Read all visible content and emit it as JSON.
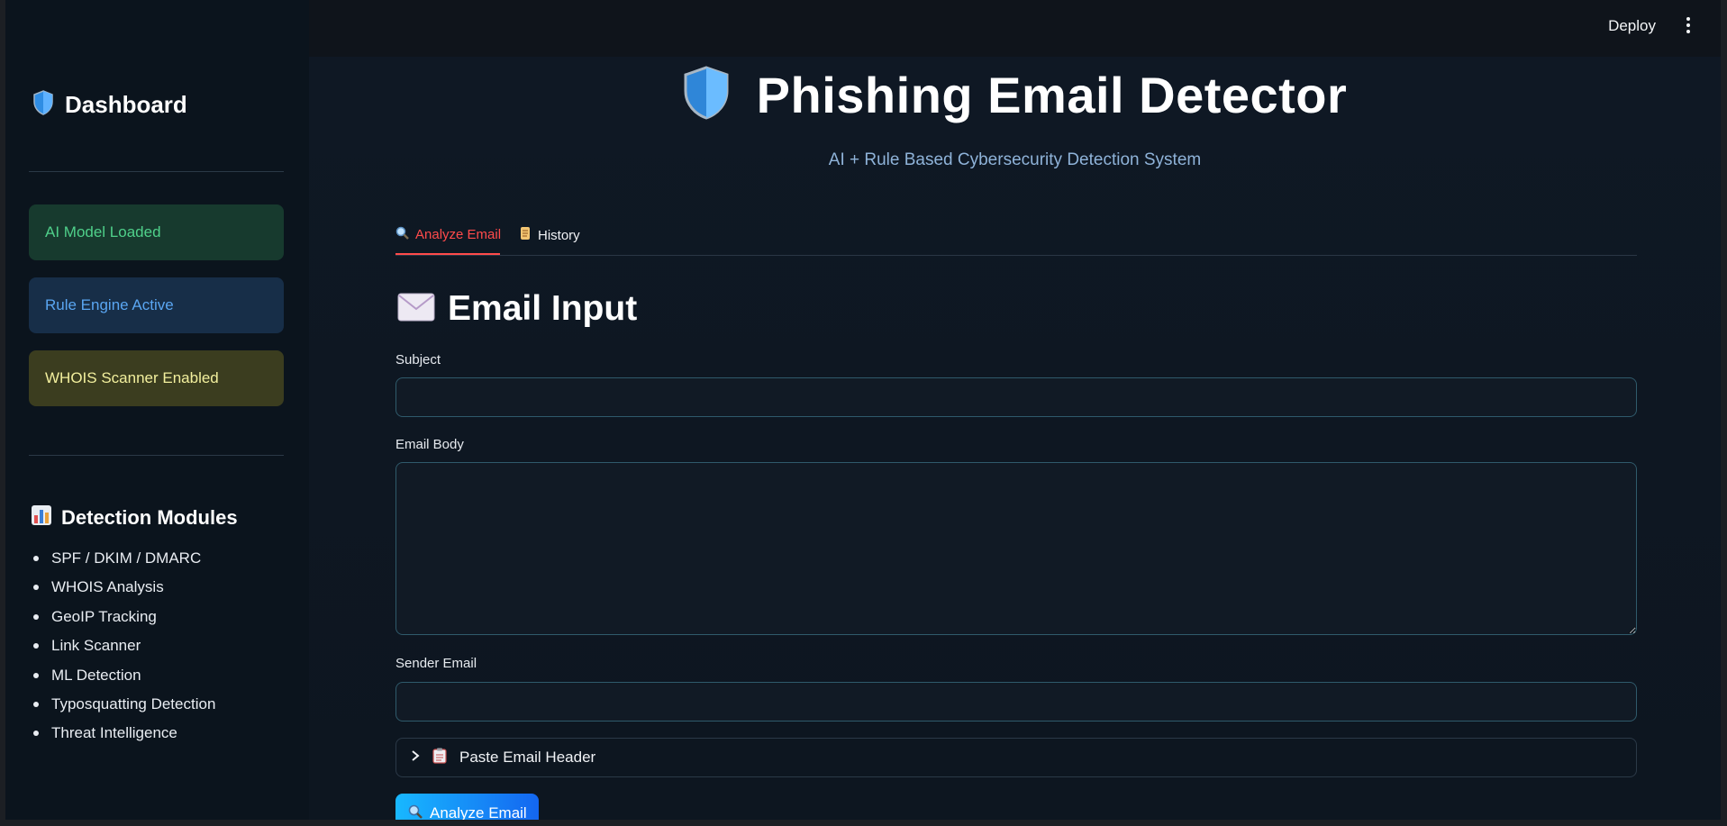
{
  "topbar": {
    "deploy_label": "Deploy"
  },
  "sidebar": {
    "title": "Dashboard",
    "status": {
      "ai_model": "AI Model Loaded",
      "rule_engine": "Rule Engine Active",
      "whois": "WHOIS Scanner Enabled"
    },
    "modules_title": "Detection Modules",
    "modules": [
      "SPF / DKIM / DMARC",
      "WHOIS Analysis",
      "GeoIP Tracking",
      "Link Scanner",
      "ML Detection",
      "Typosquatting Detection",
      "Threat Intelligence"
    ]
  },
  "main": {
    "title": "Phishing Email Detector",
    "subtitle": "AI + Rule Based Cybersecurity Detection System",
    "tabs": [
      {
        "label": "Analyze Email",
        "icon": "magnifier-icon",
        "active": true
      },
      {
        "label": "History",
        "icon": "scroll-icon",
        "active": false
      }
    ],
    "section_title": "Email Input",
    "subject_label": "Subject",
    "subject_value": "",
    "body_label": "Email Body",
    "body_value": "",
    "sender_label": "Sender Email",
    "sender_value": "",
    "expander_label": "Paste Email Header",
    "analyze_button": "Analyze Email"
  },
  "colors": {
    "accent_red": "#ff4b4b",
    "status_green": "#4fd08a",
    "status_blue": "#5aa6f2",
    "status_yellow": "#f2ef9d",
    "button_gradient_start": "#18b8ff",
    "button_gradient_end": "#1466f0"
  }
}
